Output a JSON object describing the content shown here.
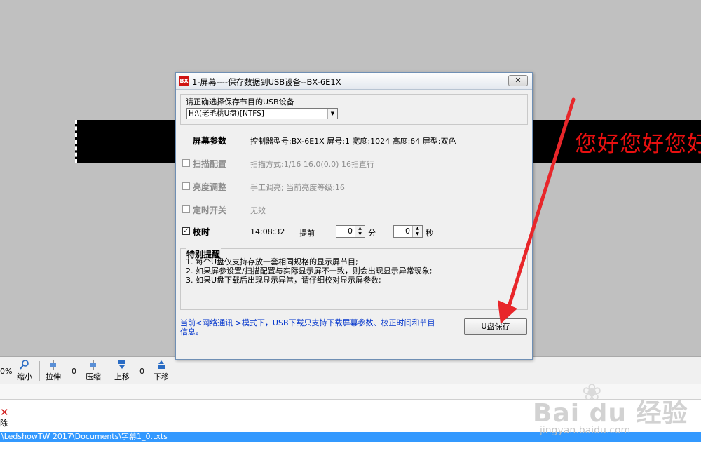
{
  "led_preview": {
    "text": "您好您好您好"
  },
  "dialog": {
    "title": "1-屏幕----保存数据到USB设备--BX-6E1X",
    "app_icon": "BX",
    "close_label": "✕",
    "usb_group_label": "请正确选择保存节目的USB设备",
    "usb_device_selected": "H:\\(老毛桃U盘)[NTFS]",
    "screen_params": {
      "label": "屏幕参数",
      "info": "控制器型号:BX-6E1X  屏号:1  宽度:1024  高度:64  屏型:双色"
    },
    "scan_config": {
      "label": "扫描配置",
      "info": "扫描方式:1/16    16.0(0.0)  16扫直行",
      "checked": false,
      "enabled": false
    },
    "brightness": {
      "label": "亮度调整",
      "info": "手工调亮; 当前亮度等级:16",
      "checked": false,
      "enabled": false
    },
    "timer_switch": {
      "label": "定时开关",
      "info": "无效",
      "checked": false,
      "enabled": false
    },
    "time_sync": {
      "label": "校时",
      "checked": true,
      "time": "14:08:32",
      "advance_label": "提前",
      "minutes_value": "0",
      "minutes_unit": "分",
      "seconds_value": "0",
      "seconds_unit": "秒"
    },
    "notice": {
      "title": "特别提醒",
      "lines": [
        "1. 每个U盘仅支持存放一套相同规格的显示屏节目;",
        "2. 如果屏参设置/扫描配置与实际显示屏不一致，则会出现显示异常现象;",
        "3. 如果U盘下载后出现显示异常，请仔细校对显示屏参数;"
      ]
    },
    "blue_note": "当前<网络通讯 >模式下，USB下载只支持下载屏幕参数、校正时间和节目信息。",
    "save_button": "U盘保存",
    "status_text": ""
  },
  "toolbar": {
    "zoom_partial": "0%",
    "shrink": "缩小",
    "stretch": "拉伸",
    "stretch_value": "0",
    "compress": "压缩",
    "move_up": "上移",
    "move_value": "0",
    "move_down": "下移"
  },
  "delete_label": "除",
  "path": "\\LedshowTW 2017\\Documents\\字幕1_0.txts",
  "watermark": {
    "main": "Bai du 经验",
    "sub": "jingyan.baidu.com"
  },
  "colors": {
    "led_text": "#e81010",
    "blue_note": "#0033cc",
    "path_bar": "#3399ff",
    "arrow": "#e8262a"
  }
}
